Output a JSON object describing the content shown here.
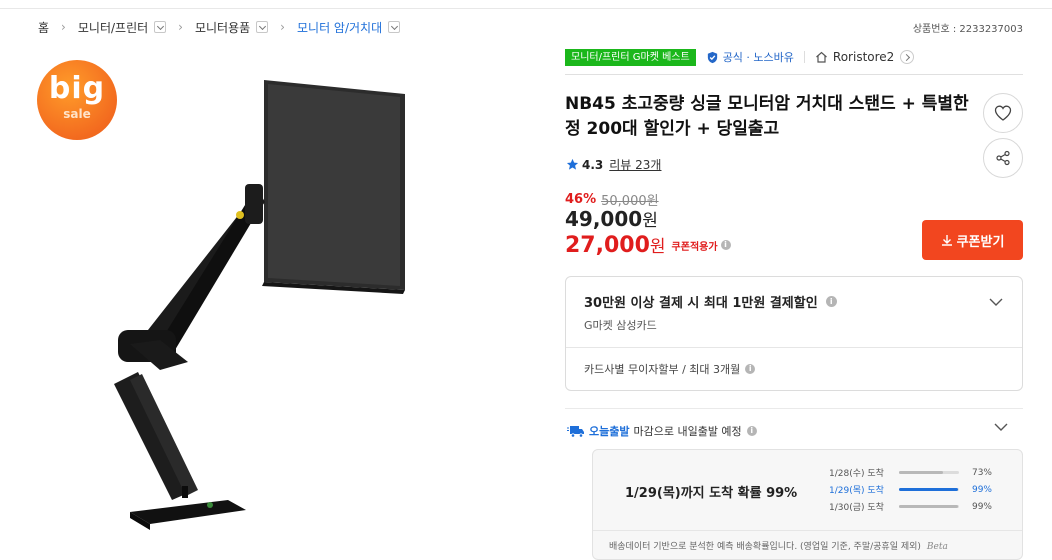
{
  "breadcrumb": {
    "items": [
      {
        "label": "홈"
      },
      {
        "label": "모니터/프린터"
      },
      {
        "label": "모니터용품"
      },
      {
        "label": "모니터 암/거치대"
      }
    ]
  },
  "product_no": "상품번호 : 2233237003",
  "promo_badge": {
    "line1": "big",
    "line2": "sale"
  },
  "badges": {
    "category_best": "모니터/프린터 G마켓 베스트",
    "official": "공식 · 노스바유",
    "store": "Roristore2"
  },
  "title": "NB45 초고중량 싱글 모니터암 거치대 스탠드 + 특별한정 200대 할인가 + 당일출고",
  "rating": {
    "score": "4.3",
    "review": "리뷰 23개"
  },
  "price": {
    "discount": "46%",
    "original": "50,000원",
    "sale_number": "49,000",
    "sale_unit": "원",
    "coupon_number": "27,000",
    "coupon_unit": "원",
    "coupon_label": "쿠폰적용가"
  },
  "coupon_button": "쿠폰받기",
  "card_benefit": {
    "main": "30만원 이상 결제 시 최대 1만원 결제할인",
    "sub": "G마켓 삼성카드",
    "installment": "카드사별 무이자할부 / 최대 3개월"
  },
  "shipping": {
    "brand": "오늘출발",
    "text": "마감으로 내일출발 예정",
    "main": "1/29(목)까지 도착 확률 99%",
    "rows": [
      {
        "date": "1/28(수) 도착",
        "percent": "73%",
        "value": 0.73
      },
      {
        "date": "1/29(목) 도착",
        "percent": "99%",
        "value": 0.99
      },
      {
        "date": "1/30(금) 도착",
        "percent": "99%",
        "value": 0.99
      }
    ],
    "footnote": "배송데이터 기반으로 분석한 예측 배송확률입니다. (영업일 기준, 주말/공휴일 제외)",
    "beta": "Beta"
  },
  "colors": {
    "accent_blue": "#1e6fd9",
    "sale_red": "#e01d1d",
    "coupon_orange": "#f2461f",
    "best_green": "#1bb71b"
  }
}
